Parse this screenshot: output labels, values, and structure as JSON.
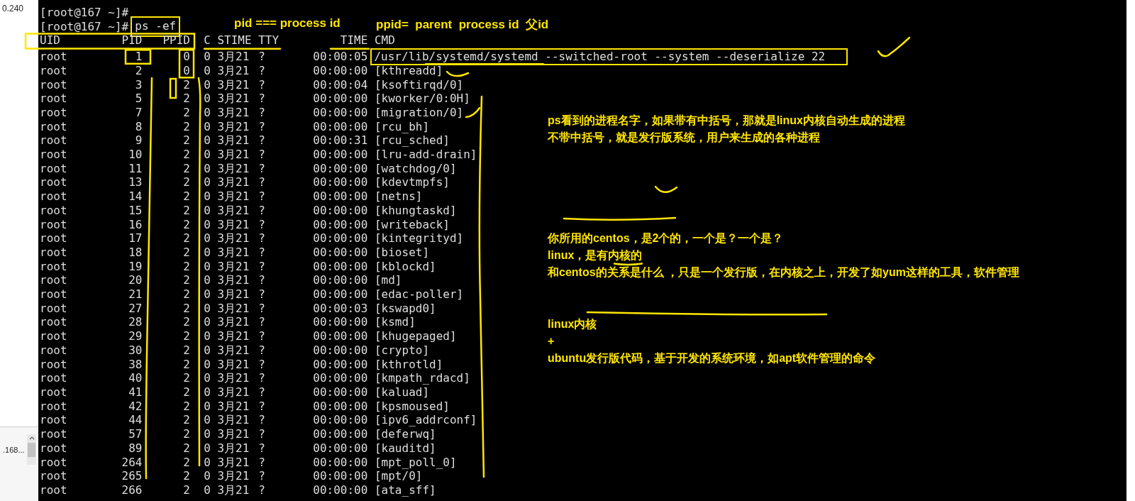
{
  "left_panel": {
    "label": "0.240",
    "list_item": ".168..."
  },
  "terminal": {
    "prompts": [
      {
        "prompt": "[root@167 ~]#"
      },
      {
        "prompt": "[root@167 ~]#",
        "command": "ps -ef",
        "boxed": true
      }
    ],
    "columns": [
      "UID",
      "PID",
      "PPID",
      "C",
      "STIME",
      "TTY",
      "TIME",
      "CMD"
    ],
    "rows": [
      {
        "uid": "root",
        "pid": "1",
        "ppid": "0",
        "c": "0",
        "stime": "3月21",
        "tty": "?",
        "time": "00:00:05",
        "cmd": "/usr/lib/systemd/systemd --switched-root --system --deserialize 22",
        "boxed": true
      },
      {
        "uid": "root",
        "pid": "2",
        "ppid": "0",
        "c": "0",
        "stime": "3月21",
        "tty": "?",
        "time": "00:00:00",
        "cmd": "[kthreadd]"
      },
      {
        "uid": "root",
        "pid": "3",
        "ppid": "2",
        "c": "0",
        "stime": "3月21",
        "tty": "?",
        "time": "00:00:04",
        "cmd": "[ksoftirqd/0]"
      },
      {
        "uid": "root",
        "pid": "5",
        "ppid": "2",
        "c": "0",
        "stime": "3月21",
        "tty": "?",
        "time": "00:00:00",
        "cmd": "[kworker/0:0H]"
      },
      {
        "uid": "root",
        "pid": "7",
        "ppid": "2",
        "c": "0",
        "stime": "3月21",
        "tty": "?",
        "time": "00:00:00",
        "cmd": "[migration/0]"
      },
      {
        "uid": "root",
        "pid": "8",
        "ppid": "2",
        "c": "0",
        "stime": "3月21",
        "tty": "?",
        "time": "00:00:00",
        "cmd": "[rcu_bh]"
      },
      {
        "uid": "root",
        "pid": "9",
        "ppid": "2",
        "c": "0",
        "stime": "3月21",
        "tty": "?",
        "time": "00:00:31",
        "cmd": "[rcu_sched]"
      },
      {
        "uid": "root",
        "pid": "10",
        "ppid": "2",
        "c": "0",
        "stime": "3月21",
        "tty": "?",
        "time": "00:00:00",
        "cmd": "[lru-add-drain]"
      },
      {
        "uid": "root",
        "pid": "11",
        "ppid": "2",
        "c": "0",
        "stime": "3月21",
        "tty": "?",
        "time": "00:00:00",
        "cmd": "[watchdog/0]"
      },
      {
        "uid": "root",
        "pid": "13",
        "ppid": "2",
        "c": "0",
        "stime": "3月21",
        "tty": "?",
        "time": "00:00:00",
        "cmd": "[kdevtmpfs]"
      },
      {
        "uid": "root",
        "pid": "14",
        "ppid": "2",
        "c": "0",
        "stime": "3月21",
        "tty": "?",
        "time": "00:00:00",
        "cmd": "[netns]"
      },
      {
        "uid": "root",
        "pid": "15",
        "ppid": "2",
        "c": "0",
        "stime": "3月21",
        "tty": "?",
        "time": "00:00:00",
        "cmd": "[khungtaskd]"
      },
      {
        "uid": "root",
        "pid": "16",
        "ppid": "2",
        "c": "0",
        "stime": "3月21",
        "tty": "?",
        "time": "00:00:00",
        "cmd": "[writeback]"
      },
      {
        "uid": "root",
        "pid": "17",
        "ppid": "2",
        "c": "0",
        "stime": "3月21",
        "tty": "?",
        "time": "00:00:00",
        "cmd": "[kintegrityd]"
      },
      {
        "uid": "root",
        "pid": "18",
        "ppid": "2",
        "c": "0",
        "stime": "3月21",
        "tty": "?",
        "time": "00:00:00",
        "cmd": "[bioset]"
      },
      {
        "uid": "root",
        "pid": "19",
        "ppid": "2",
        "c": "0",
        "stime": "3月21",
        "tty": "?",
        "time": "00:00:00",
        "cmd": "[kblockd]"
      },
      {
        "uid": "root",
        "pid": "20",
        "ppid": "2",
        "c": "0",
        "stime": "3月21",
        "tty": "?",
        "time": "00:00:00",
        "cmd": "[md]"
      },
      {
        "uid": "root",
        "pid": "21",
        "ppid": "2",
        "c": "0",
        "stime": "3月21",
        "tty": "?",
        "time": "00:00:00",
        "cmd": "[edac-poller]"
      },
      {
        "uid": "root",
        "pid": "27",
        "ppid": "2",
        "c": "0",
        "stime": "3月21",
        "tty": "?",
        "time": "00:00:03",
        "cmd": "[kswapd0]"
      },
      {
        "uid": "root",
        "pid": "28",
        "ppid": "2",
        "c": "0",
        "stime": "3月21",
        "tty": "?",
        "time": "00:00:00",
        "cmd": "[ksmd]"
      },
      {
        "uid": "root",
        "pid": "29",
        "ppid": "2",
        "c": "0",
        "stime": "3月21",
        "tty": "?",
        "time": "00:00:00",
        "cmd": "[khugepaged]"
      },
      {
        "uid": "root",
        "pid": "30",
        "ppid": "2",
        "c": "0",
        "stime": "3月21",
        "tty": "?",
        "time": "00:00:00",
        "cmd": "[crypto]"
      },
      {
        "uid": "root",
        "pid": "38",
        "ppid": "2",
        "c": "0",
        "stime": "3月21",
        "tty": "?",
        "time": "00:00:00",
        "cmd": "[kthrotld]"
      },
      {
        "uid": "root",
        "pid": "40",
        "ppid": "2",
        "c": "0",
        "stime": "3月21",
        "tty": "?",
        "time": "00:00:00",
        "cmd": "[kmpath_rdacd]"
      },
      {
        "uid": "root",
        "pid": "41",
        "ppid": "2",
        "c": "0",
        "stime": "3月21",
        "tty": "?",
        "time": "00:00:00",
        "cmd": "[kaluad]"
      },
      {
        "uid": "root",
        "pid": "42",
        "ppid": "2",
        "c": "0",
        "stime": "3月21",
        "tty": "?",
        "time": "00:00:00",
        "cmd": "[kpsmoused]"
      },
      {
        "uid": "root",
        "pid": "44",
        "ppid": "2",
        "c": "0",
        "stime": "3月21",
        "tty": "?",
        "time": "00:00:00",
        "cmd": "[ipv6_addrconf]"
      },
      {
        "uid": "root",
        "pid": "57",
        "ppid": "2",
        "c": "0",
        "stime": "3月21",
        "tty": "?",
        "time": "00:00:00",
        "cmd": "[deferwq]"
      },
      {
        "uid": "root",
        "pid": "89",
        "ppid": "2",
        "c": "0",
        "stime": "3月21",
        "tty": "?",
        "time": "00:00:00",
        "cmd": "[kauditd]"
      },
      {
        "uid": "root",
        "pid": "264",
        "ppid": "2",
        "c": "0",
        "stime": "3月21",
        "tty": "?",
        "time": "00:00:00",
        "cmd": "[mpt_poll_0]"
      },
      {
        "uid": "root",
        "pid": "265",
        "ppid": "2",
        "c": "0",
        "stime": "3月21",
        "tty": "?",
        "time": "00:00:00",
        "cmd": "[mpt/0]"
      },
      {
        "uid": "root",
        "pid": "266",
        "ppid": "2",
        "c": "0",
        "stime": "3月21",
        "tty": "?",
        "time": "00:00:00",
        "cmd": "[ata_sff]"
      }
    ]
  },
  "annotations": {
    "header_notes": [
      "pid === process id",
      "ppid=  parent  process id  父id"
    ],
    "note_blocks": [
      [
        "ps看到的进程名字，如果带有中括号，那就是linux内核自动生成的进程",
        "不带中括号，就是发行版系统，用户来生成的各种进程"
      ],
      [
        "你所用的centos，是2个的，一个是？一个是？",
        "linux，是有内核的",
        "和centos的关系是什么 ，只是一个发行版，在内核之上，开发了如yum这样的工具，软件管理"
      ],
      [
        "linux内核",
        "+",
        "ubuntu发行版代码，基于开发的系统环境，如apt软件管理的命令"
      ]
    ]
  }
}
